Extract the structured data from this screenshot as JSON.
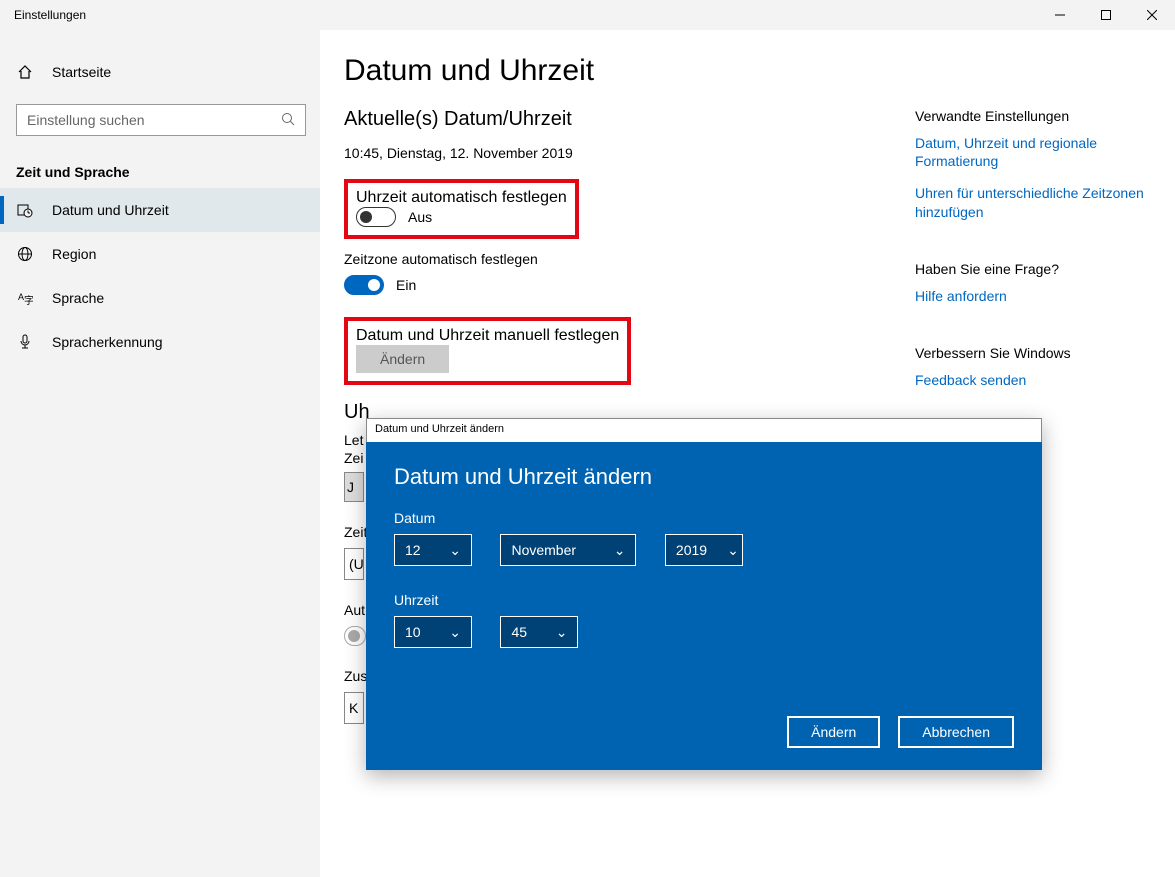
{
  "window": {
    "title": "Einstellungen"
  },
  "sidebar": {
    "home": "Startseite",
    "search_placeholder": "Einstellung suchen",
    "section": "Zeit und Sprache",
    "items": [
      {
        "label": "Datum und Uhrzeit"
      },
      {
        "label": "Region"
      },
      {
        "label": "Sprache"
      },
      {
        "label": "Spracherkennung"
      }
    ]
  },
  "main": {
    "title": "Datum und Uhrzeit",
    "subtitle": "Aktuelle(s) Datum/Uhrzeit",
    "current": "10:45, Dienstag, 12. November 2019",
    "auto_time_label": "Uhrzeit automatisch festlegen",
    "auto_time_state": "Aus",
    "auto_tz_label": "Zeitzone automatisch festlegen",
    "auto_tz_state": "Ein",
    "manual_label": "Datum und Uhrzeit manuell festlegen",
    "change_btn": "Ändern",
    "sync_head": "Uh",
    "sync_line1": "Let",
    "sync_line2": "Zei",
    "sync_btn": "J",
    "tz_label": "Zeit",
    "tz_value": "(U",
    "dst_label": "Aut",
    "extra_label": "Zus",
    "extra_value": "K"
  },
  "right": {
    "related": "Verwandte Einstellungen",
    "link1": "Datum, Uhrzeit und regionale Formatierung",
    "link2": "Uhren für unterschiedliche Zeitzonen hinzufügen",
    "question": "Haben Sie eine Frage?",
    "help": "Hilfe anfordern",
    "improve": "Verbessern Sie Windows",
    "feedback": "Feedback senden"
  },
  "dialog": {
    "bar": "Datum und Uhrzeit ändern",
    "title": "Datum und Uhrzeit ändern",
    "date_lbl": "Datum",
    "time_lbl": "Uhrzeit",
    "day": "12",
    "month": "November",
    "year": "2019",
    "hour": "10",
    "minute": "45",
    "ok": "Ändern",
    "cancel": "Abbrechen"
  }
}
